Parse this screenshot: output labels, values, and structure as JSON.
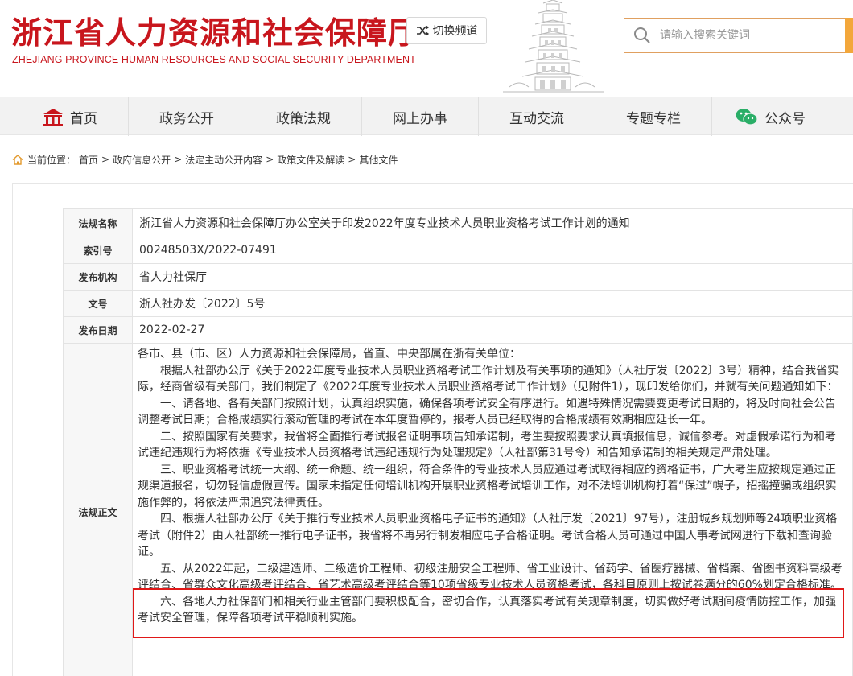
{
  "header": {
    "logo_cn": "浙江省人力资源和社会保障厅",
    "logo_en": "ZHEJIANG PROVINCE HUMAN RESOURCES AND SOCIAL SECURITY DEPARTMENT",
    "switch_label": "切换频道",
    "search_placeholder": "请输入搜索关键词"
  },
  "colors": {
    "brand": "#c8161d",
    "accent": "#f3a73b",
    "highlight": "#e01818"
  },
  "nav": {
    "items": [
      {
        "label": "首页",
        "icon": "home-icon"
      },
      {
        "label": "政务公开"
      },
      {
        "label": "政策法规"
      },
      {
        "label": "网上办事"
      },
      {
        "label": "互动交流"
      },
      {
        "label": "专题专栏"
      },
      {
        "label": "公众号",
        "icon": "wechat-icon"
      }
    ]
  },
  "breadcrumb": {
    "prefix": "当前位置：",
    "items": [
      "首页",
      "政府信息公开",
      "法定主动公开内容",
      "政策文件及解读",
      "其他文件"
    ]
  },
  "meta": {
    "rows": [
      {
        "label": "法规名称",
        "value": "浙江省人力资源和社会保障厅办公室关于印发2022年度专业技术人员职业资格考试工作计划的通知"
      },
      {
        "label": "索引号",
        "value": "00248503X/2022-07491"
      },
      {
        "label": "发布机构",
        "value": "省人力社保厅"
      },
      {
        "label": "文号",
        "value": "浙人社办发〔2022〕5号"
      },
      {
        "label": "发布日期",
        "value": "2022-02-27"
      }
    ],
    "body_label": "法规正文"
  },
  "body": {
    "paragraphs": [
      "各市、县（市、区）人力资源和社会保障局，省直、中央部属在浙有关单位：",
      "根据人社部办公厅《关于2022年度专业技术人员职业资格考试工作计划及有关事项的通知》（人社厅发〔2022〕3号）精神，结合我省实际，经商省级有关部门，我们制定了《2022年度专业技术人员职业资格考试工作计划》（见附件1），现印发给你们，并就有关问题通知如下：",
      "一、请各地、各有关部门按照计划，认真组织实施，确保各项考试安全有序进行。如遇特殊情况需要变更考试日期的，将及时向社会公告调整考试日期；合格成绩实行滚动管理的考试在本年度暂停的，报考人员已经取得的合格成绩有效期相应延长一年。",
      "二、按照国家有关要求，我省将全面推行考试报名证明事项告知承诺制，考生要按照要求认真填报信息，诚信参考。对虚假承诺行为和考试违纪违规行为将依据《专业技术人员资格考试违纪违规行为处理规定》（人社部第31号令）和告知承诺制的相关规定严肃处理。",
      "三、职业资格考试统一大纲、统一命题、统一组织，符合条件的专业技术人员应通过考试取得相应的资格证书，广大考生应按规定通过正规渠道报名，切勿轻信虚假宣传。国家未指定任何培训机构开展职业资格考试培训工作，对不法培训机构打着“保过”幌子，招摇撞骗或组织实施作弊的，将依法严肃追究法律责任。",
      "四、根据人社部办公厅《关于推行专业技术人员职业资格电子证书的通知》（人社厅发〔2021〕97号），注册城乡规划师等24项职业资格考试（附件2）由人社部统一推行电子证书，我省将不再另行制发相应电子合格证明。考试合格人员可通过中国人事考试网进行下载和查询验证。",
      "五、从2022年起，二级建造师、二级造价工程师、初级注册安全工程师、省工业设计、省药学、省医疗器械、省档案、省图书资料高级考评结合、省群众文化高级考评结合、省艺术高级考评结合等10项省级专业技术人员资格考试，各科目原则上按试卷满分的60%划定合格标准。",
      "六、各地人力社保部门和相关行业主管部门要积极配合，密切合作，认真落实考试有关规章制度，切实做好考试期间疫情防控工作，加强考试安全管理，保障各项考试平稳顺利实施。"
    ]
  }
}
